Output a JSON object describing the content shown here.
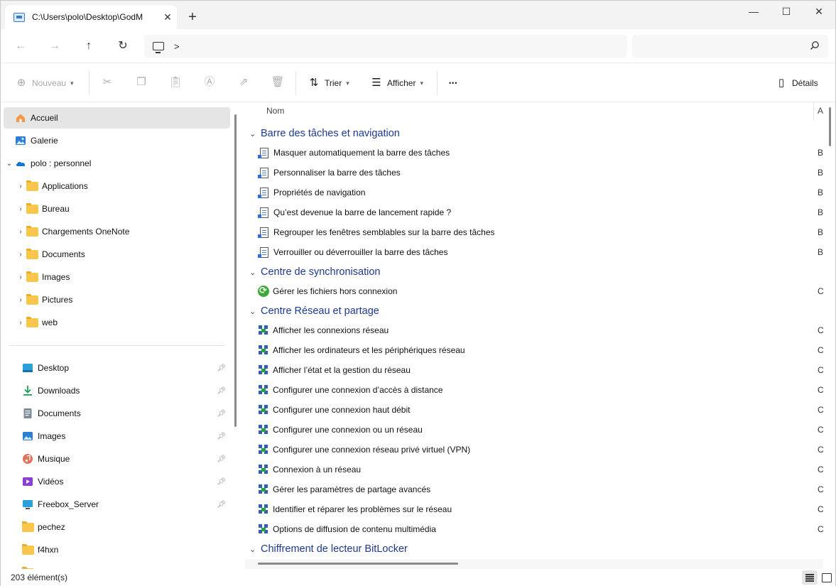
{
  "window": {
    "tab_title": "C:\\Users\\polo\\Desktop\\GodM",
    "tab_close": "✕",
    "new_tab": "+",
    "controls": {
      "minimize": "—",
      "maximize": "☐",
      "close": "✕"
    }
  },
  "address": {
    "chevron": ">",
    "search_placeholder": ""
  },
  "commands": {
    "new_label": "Nouveau",
    "sort_label": "Trier",
    "view_label": "Afficher",
    "more": "•••",
    "details_label": "Détails"
  },
  "sidebar": {
    "home": "Accueil",
    "gallery": "Galerie",
    "onedrive": "polo : personnel",
    "onedrive_folders": [
      "Applications",
      "Bureau",
      "Chargements OneNote",
      "Documents",
      "Images",
      "Pictures",
      "web"
    ],
    "quick_access": [
      {
        "label": "Desktop",
        "icon": "desktop-icon",
        "pinned": true
      },
      {
        "label": "Downloads",
        "icon": "download-icon",
        "pinned": true
      },
      {
        "label": "Documents",
        "icon": "documents-icon",
        "pinned": true
      },
      {
        "label": "Images",
        "icon": "images-icon",
        "pinned": true
      },
      {
        "label": "Musique",
        "icon": "music-icon",
        "pinned": true
      },
      {
        "label": "Vidéos",
        "icon": "videos-icon",
        "pinned": true
      },
      {
        "label": "Freebox_Server",
        "icon": "network-drive-icon",
        "pinned": true
      },
      {
        "label": "pechez",
        "icon": "folder-icon",
        "pinned": false
      },
      {
        "label": "f4hxn",
        "icon": "folder-icon",
        "pinned": false
      }
    ]
  },
  "content": {
    "column_name": "Nom",
    "column_a": "A",
    "groups": [
      {
        "title": "Barre des tâches et navigation",
        "icon": "doc",
        "col": "B",
        "items": [
          "Masquer automatiquement la barre des tâches",
          "Personnaliser la barre des tâches",
          "Propriétés de navigation",
          "Qu’est devenue la barre de lancement rapide ?",
          "Regrouper les fenêtres semblables sur la barre des tâches",
          "Verrouiller ou déverrouiller la barre des tâches"
        ]
      },
      {
        "title": "Centre de synchronisation",
        "icon": "sync",
        "col": "C",
        "items": [
          "Gérer les fichiers hors connexion"
        ]
      },
      {
        "title": "Centre Réseau et partage",
        "icon": "net",
        "col": "C",
        "items": [
          "Afficher les connexions réseau",
          "Afficher les ordinateurs et les périphériques réseau",
          "Afficher l’état et la gestion du réseau",
          "Configurer une connexion d’accès à distance",
          "Configurer une connexion haut débit",
          "Configurer une connexion ou un réseau",
          "Configurer une connexion réseau privé virtuel (VPN)",
          "Connexion à un réseau",
          "Gérer les paramètres de partage avancés",
          "Identifier et réparer les problèmes sur le réseau",
          "Options de diffusion de contenu multimédia"
        ]
      },
      {
        "title": "Chiffrement de lecteur BitLocker",
        "icon": "doc",
        "col": "",
        "items": []
      }
    ]
  },
  "status": {
    "count": "203 élément(s)"
  }
}
